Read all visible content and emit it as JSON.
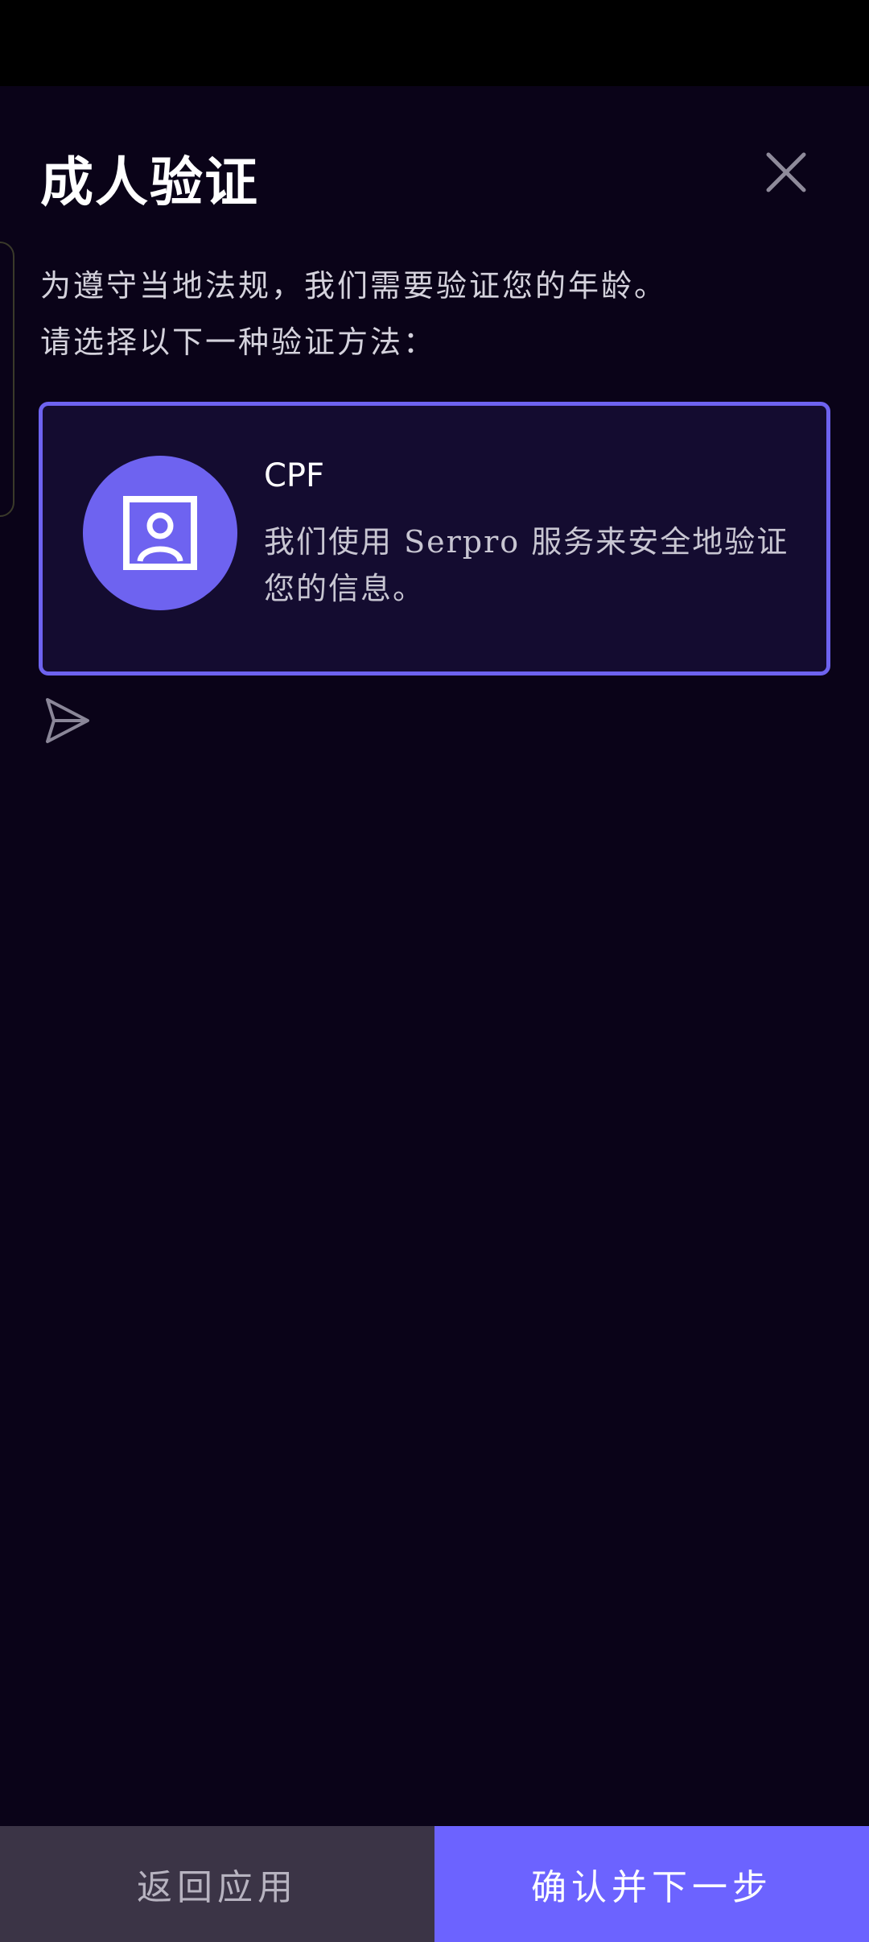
{
  "header": {
    "title": "成人验证",
    "close_icon": "close-icon"
  },
  "intro": {
    "line1": "为遵守当地法规，我们需要验证您的年龄。",
    "line2": "请选择以下一种验证方法："
  },
  "options": [
    {
      "title": "CPF",
      "description": "我们使用 Serpro 服务来安全地验证您的信息。",
      "icon": "id-card-icon",
      "selected": true
    }
  ],
  "floating": {
    "icon": "send-icon"
  },
  "footer": {
    "back_label": "返回应用",
    "next_label": "确认并下一步"
  },
  "colors": {
    "background": "#0a0318",
    "accent": "#6c63ff",
    "card_background": "#140c30",
    "back_button": "#3b3446"
  }
}
